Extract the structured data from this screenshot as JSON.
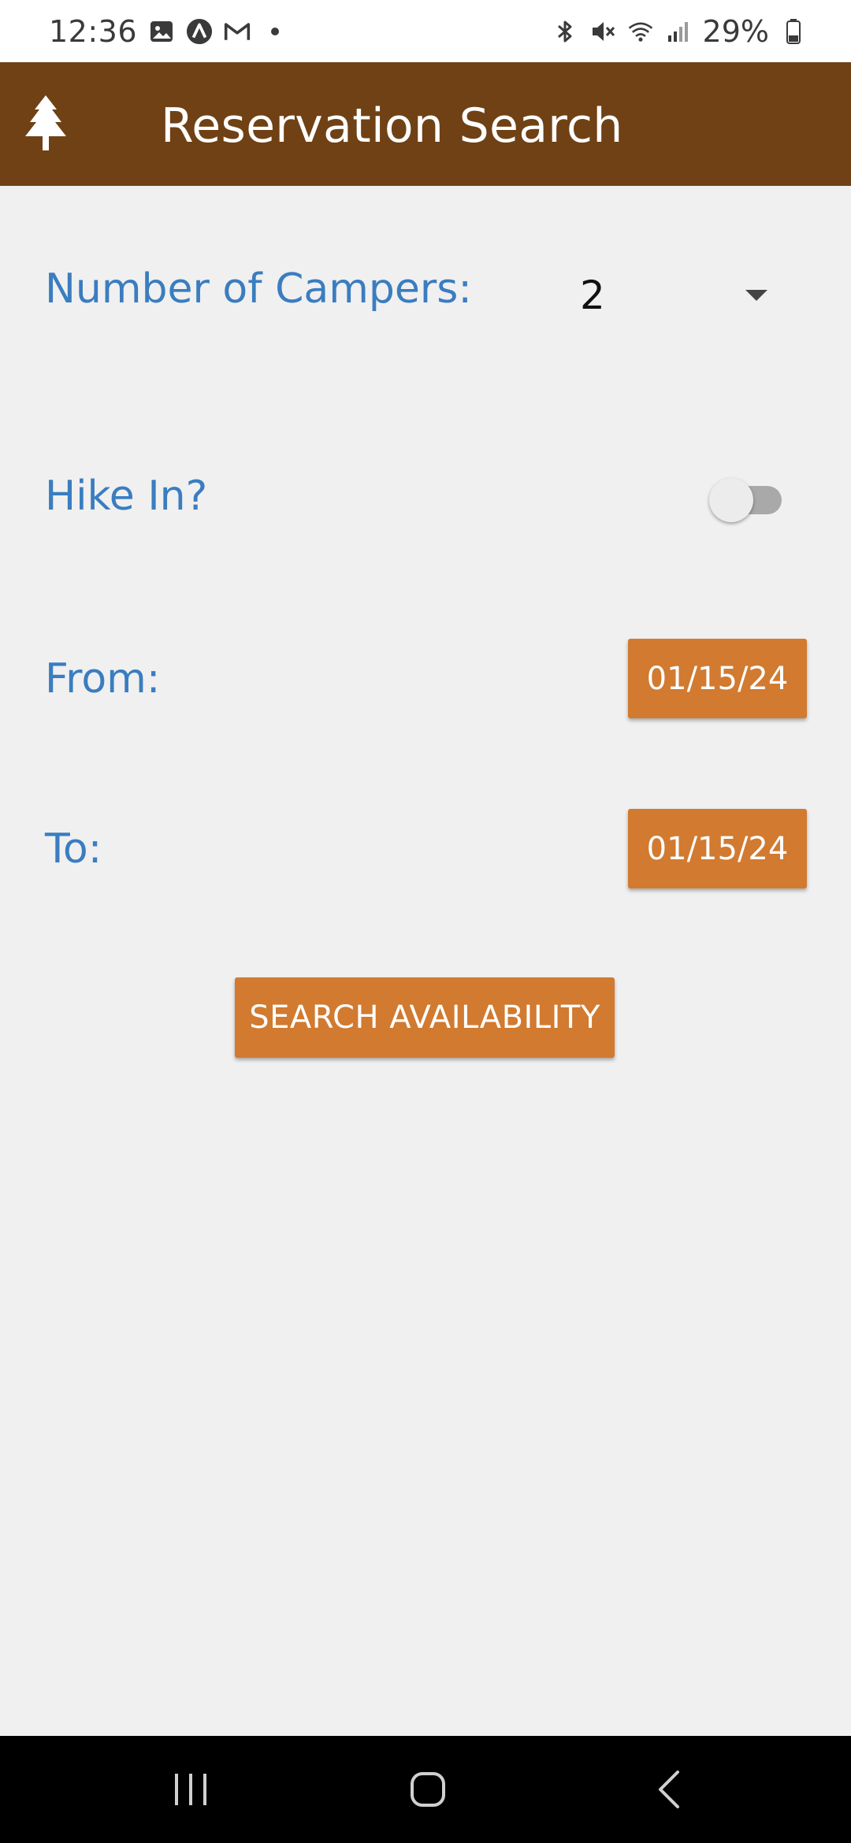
{
  "status_bar": {
    "time": "12:36",
    "left_icons": [
      "image-icon",
      "circle-a-icon",
      "gmail-icon",
      "dot-icon"
    ],
    "right_icons": [
      "bluetooth-icon",
      "mute-icon",
      "wifi-icon",
      "signal-icon"
    ],
    "battery": "29%"
  },
  "app_bar": {
    "title": "Reservation Search",
    "icon": "tree-icon",
    "color": "#6f4114"
  },
  "form": {
    "campers_label": "Number of Campers:",
    "campers_value": "2",
    "hike_in_label": "Hike In?",
    "hike_in_enabled": false,
    "from_label": "From:",
    "from_date": "01/15/24",
    "to_label": "To:",
    "to_date": "01/15/24",
    "search_button": "SEARCH AVAILABILITY"
  },
  "colors": {
    "accent": "#d17a30",
    "label": "#3a7dc0",
    "background": "#f0f0f0"
  },
  "nav_bar": {
    "icons": [
      "recents-icon",
      "home-icon",
      "back-icon"
    ]
  }
}
